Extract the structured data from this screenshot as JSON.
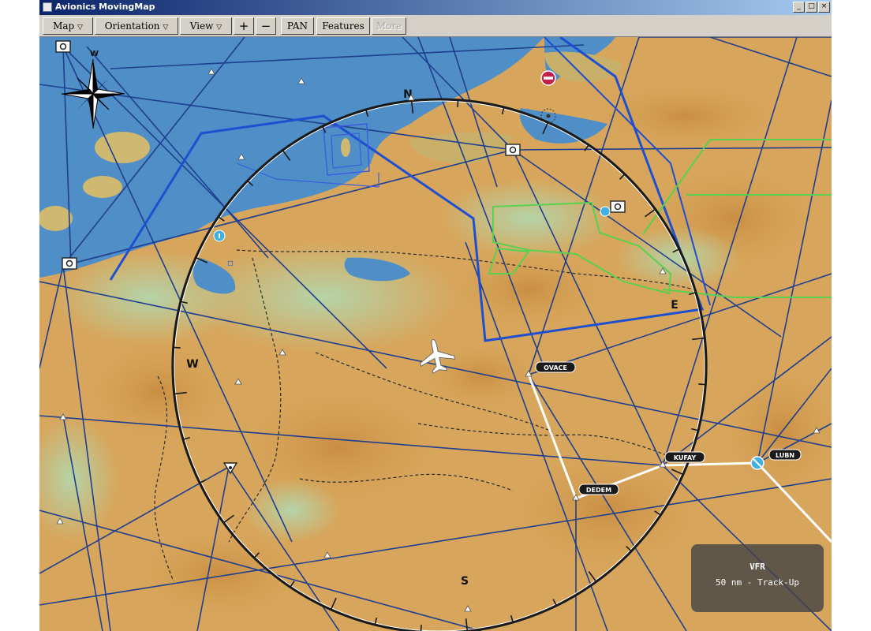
{
  "window": {
    "title": "Avionics MovingMap",
    "controls": {
      "minimize": "_",
      "maximize": "□",
      "close": "×"
    }
  },
  "toolbar": {
    "map": "Map",
    "orientation": "Orientation",
    "view": "View",
    "zoom_in": "+",
    "zoom_out": "−",
    "pan": "PAN",
    "features": "Features",
    "more": "More"
  },
  "map": {
    "compass_rose": {
      "N": "N",
      "E": "E",
      "S": "S",
      "W": "W"
    },
    "corner_rose_label": "W",
    "waypoints": {
      "ovace": "OVACE",
      "kufay": "KUFAY",
      "dedem": "DEDEM",
      "lubn": "LUBN"
    }
  },
  "status": {
    "mode": "VFR",
    "range": "50 nm - Track-Up"
  },
  "colors": {
    "sea": "#4f8ec6",
    "terrain_low": "#a7c9a0",
    "terrain_high": "#d9a85b",
    "airway": "#1f3f8f",
    "airspace_blue": "#1e4fd0",
    "airspace_green": "#59d14f",
    "route": "#ffffff",
    "status_bg": "#464646"
  },
  "icons": {
    "aircraft": "airplane-icon",
    "compass": "compass-rose-icon",
    "north_arrow": "north-arrow-icon",
    "vor": "vor-icon",
    "restricted": "no-entry-icon",
    "info": "info-icon"
  }
}
